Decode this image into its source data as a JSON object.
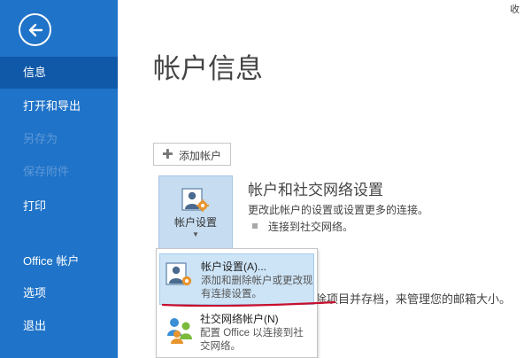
{
  "window": {
    "collapse_label": "收"
  },
  "sidebar": {
    "items": [
      {
        "label": "信息"
      },
      {
        "label": "打开和导出"
      },
      {
        "label": "另存为"
      },
      {
        "label": "保存附件"
      },
      {
        "label": "打印"
      },
      {
        "label": "Office 帐户"
      },
      {
        "label": "选项"
      },
      {
        "label": "退出"
      }
    ]
  },
  "main": {
    "title": "帐户信息",
    "add_account_label": "添加帐户",
    "account_settings_label": "帐户设置",
    "section_heading": "帐户和社交网络设置",
    "section_desc": "更改此帐户的设置或设置更多的连接。",
    "bullet_text": "连接到社交网络。",
    "mailbox_text": "除项目并存档，来管理您的邮箱大小。"
  },
  "dropdown": {
    "items": [
      {
        "title": "帐户设置(A)...",
        "desc": "添加和删除帐户或更改现有连接设置。"
      },
      {
        "title": "社交网络帐户(N)",
        "desc": "配置 Office 以连接到社交网络。"
      }
    ]
  },
  "colors": {
    "sidebar": "#1f73c8",
    "sidebar_active": "#1059a8",
    "sidebar_disabled_text": "#5e98d8",
    "menu_highlight": "#cde4f7",
    "annotation": "#c8102e"
  }
}
